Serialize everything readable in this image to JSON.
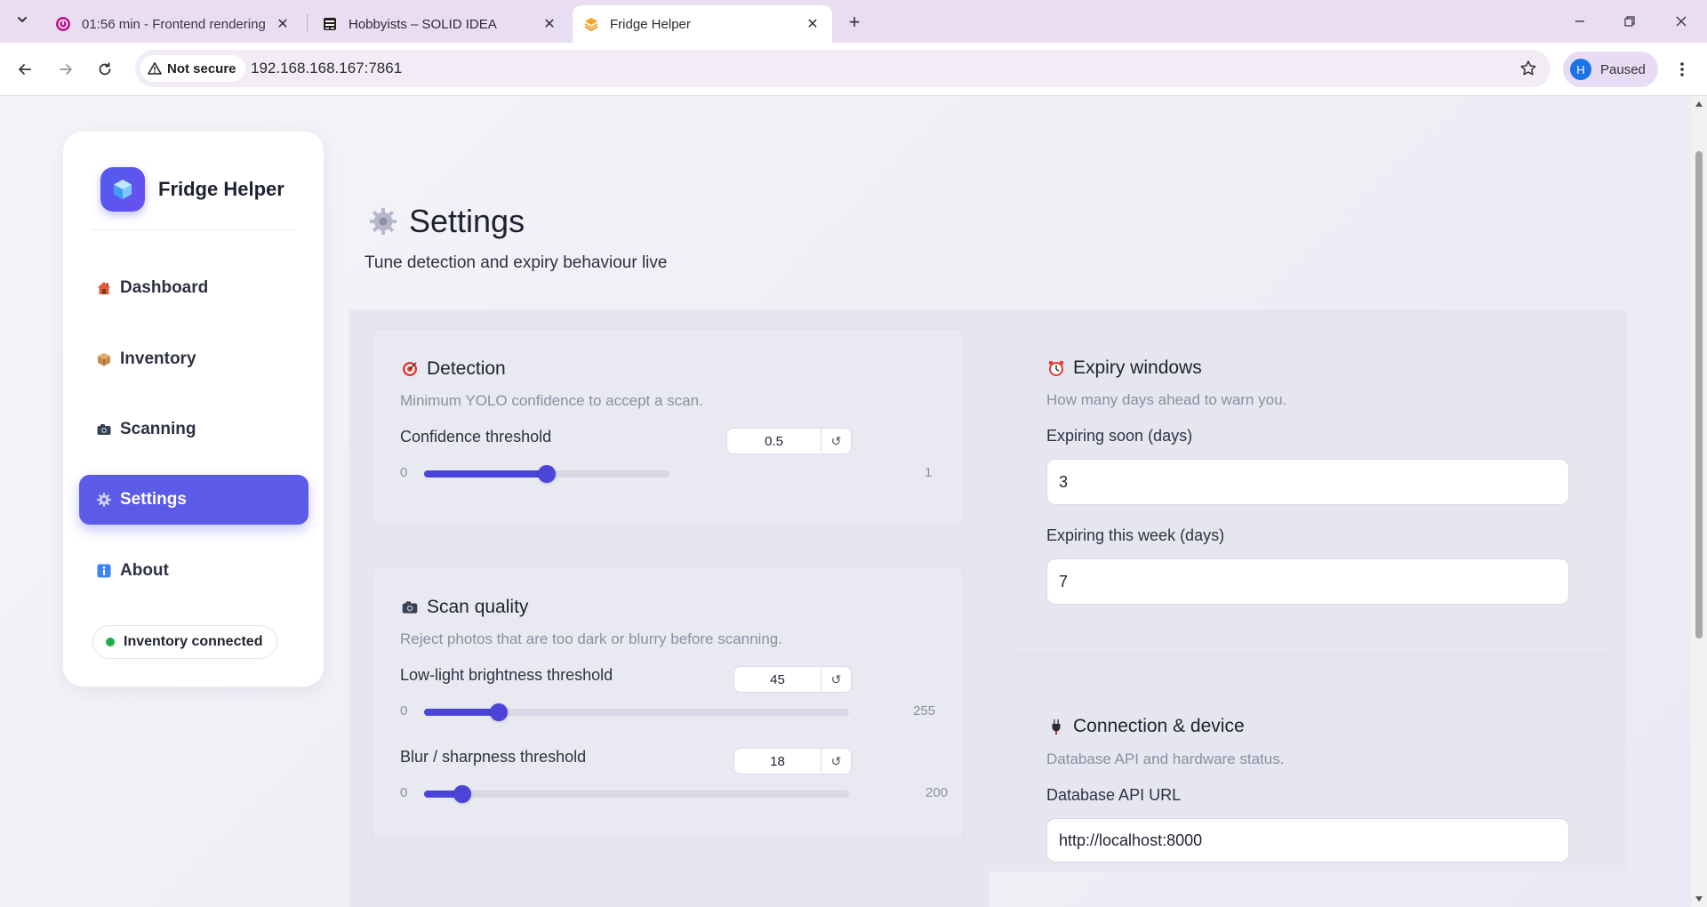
{
  "browser": {
    "tabs": [
      {
        "title": "01:56 min - Frontend rendering",
        "active": false
      },
      {
        "title": "Hobbyists – SOLID IDEA",
        "active": false
      },
      {
        "title": "Fridge Helper",
        "active": true
      }
    ],
    "security_label": "Not secure",
    "url": "192.168.168.167:7861",
    "profile_initial": "H",
    "profile_status": "Paused"
  },
  "sidebar": {
    "brand": "Fridge Helper",
    "items": [
      {
        "label": "Dashboard",
        "icon": "house-emoji-icon",
        "active": false
      },
      {
        "label": "Inventory",
        "icon": "package-emoji-icon",
        "active": false
      },
      {
        "label": "Scanning",
        "icon": "camera-emoji-icon",
        "active": false
      },
      {
        "label": "Settings",
        "icon": "gear-emoji-icon",
        "active": true
      },
      {
        "label": "About",
        "icon": "info-emoji-icon",
        "active": false
      }
    ],
    "status": "Inventory connected",
    "status_color": "#1fae4b"
  },
  "header": {
    "title": "Settings",
    "subtitle": "Tune detection and expiry behaviour live"
  },
  "detection": {
    "title": "Detection",
    "description": "Minimum YOLO confidence to accept a scan.",
    "confidence": {
      "label": "Confidence threshold",
      "value": "0.5",
      "min": "0",
      "max": "1"
    }
  },
  "scan_quality": {
    "title": "Scan quality",
    "description": "Reject photos that are too dark or blurry before scanning.",
    "brightness": {
      "label": "Low-light brightness threshold",
      "value": "45",
      "min": "0",
      "max": "255"
    },
    "blur": {
      "label": "Blur / sharpness threshold",
      "value": "18",
      "min": "0",
      "max": "200"
    }
  },
  "expiry": {
    "title": "Expiry windows",
    "description": "How many days ahead to warn you.",
    "soon": {
      "label": "Expiring soon (days)",
      "value": "3"
    },
    "week": {
      "label": "Expiring this week (days)",
      "value": "7"
    }
  },
  "connection": {
    "title": "Connection & device",
    "description": "Database API and hardware status.",
    "api_url": {
      "label": "Database API URL",
      "value": "http://localhost:8000"
    }
  },
  "colors": {
    "accent": "#5b5be8",
    "slider": "#4a44d8"
  }
}
